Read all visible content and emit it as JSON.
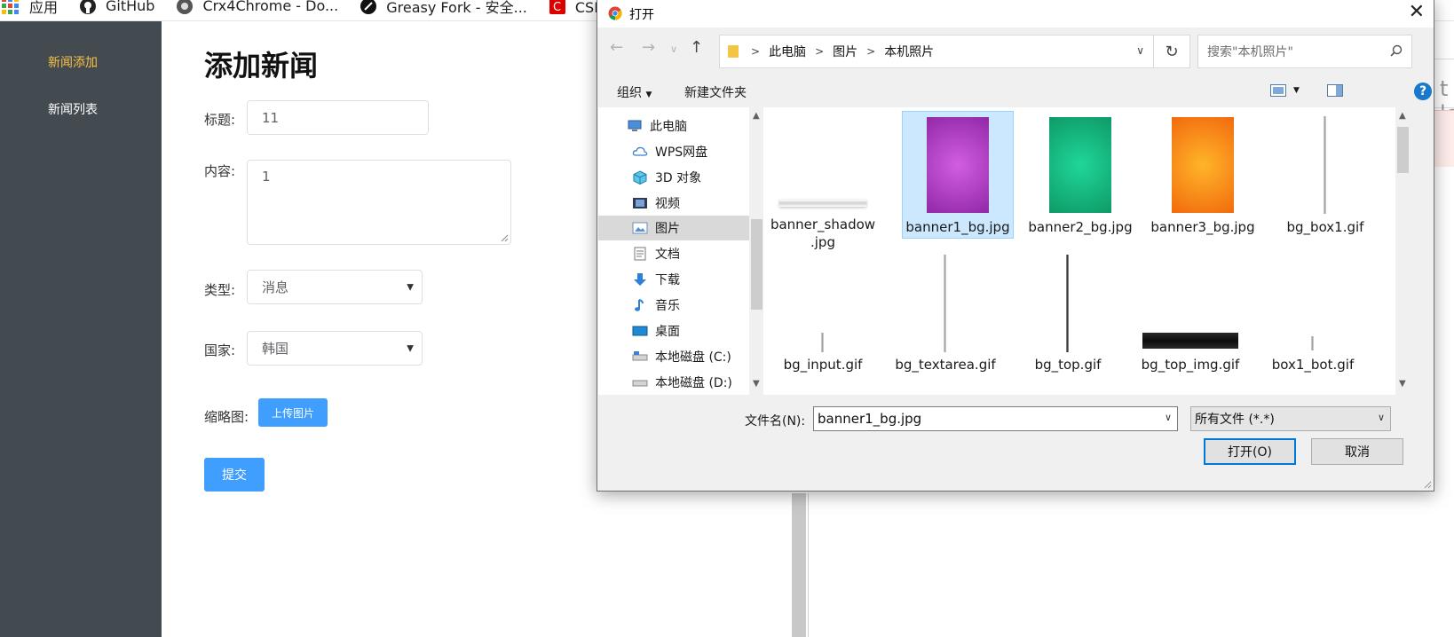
{
  "bookmarks": [
    {
      "label": "应用",
      "icon": "apps-grid-icon"
    },
    {
      "label": "GitHub",
      "icon": "github-icon"
    },
    {
      "label": "Crx4Chrome - Do...",
      "icon": "crx4chrome-icon"
    },
    {
      "label": "Greasy Fork - 安全...",
      "icon": "greasyfork-icon"
    },
    {
      "label": "CSDN博客",
      "icon": "csdn-icon"
    }
  ],
  "sidebar": {
    "items": [
      {
        "label": "新闻添加",
        "active": true
      },
      {
        "label": "新闻列表",
        "active": false
      }
    ],
    "active_color": "#f7c144"
  },
  "form": {
    "title": "添加新闻",
    "fields": {
      "title_label": "标题:",
      "title_value": "11",
      "content_label": "内容:",
      "content_value": "1",
      "type_label": "类型:",
      "type_value": "消息",
      "country_label": "国家:",
      "country_value": "韩国",
      "thumb_label": "缩略图:"
    },
    "upload_label": "上传图片",
    "submit_label": "提交",
    "accent": "#409eff"
  },
  "background_page": {
    "partial_text": "t le"
  },
  "dialog": {
    "title": "打开",
    "breadcrumb": [
      "此电脑",
      "图片",
      "本机照片"
    ],
    "search_placeholder": "搜索\"本机照片\"",
    "toolbar": {
      "organize": "组织",
      "new_folder": "新建文件夹"
    },
    "tree": [
      {
        "label": "此电脑",
        "icon": "computer-icon",
        "selected": false
      },
      {
        "label": "WPS网盘",
        "icon": "cloud-icon",
        "selected": false
      },
      {
        "label": "3D 对象",
        "icon": "cube-3d-icon",
        "selected": false
      },
      {
        "label": "视频",
        "icon": "video-icon",
        "selected": false
      },
      {
        "label": "图片",
        "icon": "pictures-icon",
        "selected": true
      },
      {
        "label": "文档",
        "icon": "document-icon",
        "selected": false
      },
      {
        "label": "下载",
        "icon": "download-icon",
        "selected": false
      },
      {
        "label": "音乐",
        "icon": "music-icon",
        "selected": false
      },
      {
        "label": "桌面",
        "icon": "desktop-icon",
        "selected": false
      },
      {
        "label": "本地磁盘 (C:)",
        "icon": "drive-icon",
        "selected": false
      },
      {
        "label": "本地磁盘 (D:)",
        "icon": "drive-icon",
        "selected": false
      }
    ],
    "files": [
      {
        "name_line1": "banner_shadow",
        "name_line2": ".jpg",
        "thumb": "shadow",
        "selected": false
      },
      {
        "name_line1": "banner1_bg.jpg",
        "name_line2": "",
        "thumb": "purple",
        "selected": true,
        "color": "#b23cc4"
      },
      {
        "name_line1": "banner2_bg.jpg",
        "name_line2": "",
        "thumb": "green",
        "selected": false,
        "color": "#18b57a"
      },
      {
        "name_line1": "banner3_bg.jpg",
        "name_line2": "",
        "thumb": "orange",
        "selected": false,
        "color": "#ff8a18"
      },
      {
        "name_line1": "bg_box1.gif",
        "name_line2": "",
        "thumb": "vline",
        "selected": false
      },
      {
        "name_line1": "bg_input.gif",
        "name_line2": "",
        "thumb": "tiny",
        "selected": false
      },
      {
        "name_line1": "bg_textarea.gif",
        "name_line2": "",
        "thumb": "vline",
        "selected": false
      },
      {
        "name_line1": "bg_top.gif",
        "name_line2": "",
        "thumb": "vline-dark",
        "selected": false
      },
      {
        "name_line1": "bg_top_img.gif",
        "name_line2": "",
        "thumb": "dark-bar",
        "selected": false
      },
      {
        "name_line1": "box1_bot.gif",
        "name_line2": "",
        "thumb": "tiny",
        "selected": false
      }
    ],
    "filename_label": "文件名(N):",
    "filename_value": "banner1_bg.jpg",
    "filetype_value": "所有文件 (*.*)",
    "open_label": "打开(O)",
    "cancel_label": "取消",
    "help_label": "?"
  }
}
